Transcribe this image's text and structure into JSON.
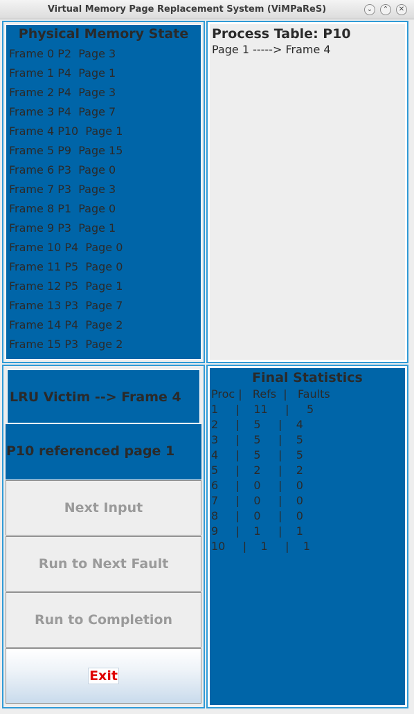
{
  "window": {
    "title": "Virtual Memory Page Replacement System (ViMPaReS)",
    "controls": [
      "chevron-down",
      "chevron-up",
      "close"
    ],
    "control_glyphs": [
      "⌄",
      "⌃",
      "✕"
    ]
  },
  "physical_memory": {
    "title": "Physical Memory State",
    "frames": [
      "Frame 0 P2  Page 3",
      "Frame 1 P4  Page 1",
      "Frame 2 P4  Page 3",
      "Frame 3 P4  Page 7",
      "Frame 4 P10  Page 1",
      "Frame 5 P9  Page 15",
      "Frame 6 P3  Page 0",
      "Frame 7 P3  Page 3",
      "Frame 8 P1  Page 0",
      "Frame 9 P3  Page 1",
      "Frame 10 P4  Page 0",
      "Frame 11 P5  Page 0",
      "Frame 12 P5  Page 1",
      "Frame 13 P3  Page 7",
      "Frame 14 P4  Page 2",
      "Frame 15 P3  Page 2"
    ]
  },
  "process_table": {
    "title": "Process Table: P10",
    "rows": [
      "Page 1 -----> Frame 4"
    ]
  },
  "status": {
    "victim": "LRU Victim --> Frame 4",
    "reference": "P10 referenced page 1"
  },
  "buttons": {
    "next_input": "Next Input",
    "run_to_next_fault": "Run to Next Fault",
    "run_to_completion": "Run to Completion",
    "exit": "Exit"
  },
  "final_statistics": {
    "title": "Final Statistics",
    "header": "Proc |   Refs  |   Faults",
    "rows": [
      "1     |    11     |     5",
      "2     |    5     |    4",
      "3     |    5     |    5",
      "4     |    5     |    5",
      "5     |    2     |    2",
      "6     |    0     |    0",
      "7     |    0     |    0",
      "8     |    0     |    0",
      "9     |    1     |    1",
      "10     |    1     |    1"
    ]
  },
  "colors": {
    "panel_blue": "#0065a8",
    "border_blue": "#2f9ad6",
    "exit_red": "#e00000",
    "disabled_text": "#9a9a9a"
  }
}
